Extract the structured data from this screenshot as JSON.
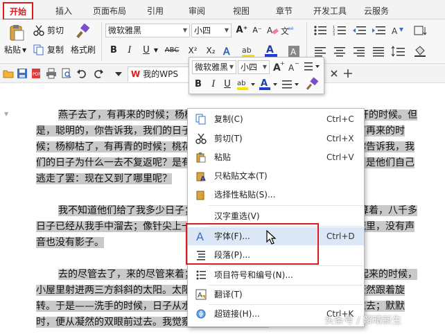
{
  "tabs": [
    "开始",
    "插入",
    "页面布局",
    "引用",
    "审阅",
    "视图",
    "章节",
    "开发工具",
    "云服务"
  ],
  "ribbon": {
    "paste_label": "粘贴",
    "cut_label": "剪切",
    "copy_label": "复制",
    "format_painter_label": "格式刷",
    "font_name": "微软雅黑",
    "font_size": "小四",
    "bold": "B",
    "italic": "I",
    "underline": "U",
    "strike": "ABC",
    "superscript": "X²",
    "subscript": "X₂",
    "font_color_glyph": "A",
    "grow_font": "A⁺",
    "shrink_font": "A⁻"
  },
  "qbar": {
    "doc_tab": "我的WPS",
    "wps_logo": "W"
  },
  "minibar": {
    "font_name": "微软雅黑",
    "font_size": "小四",
    "bold": "B",
    "italic": "I",
    "underline": "U"
  },
  "document": {
    "paragraphs": [
      "燕子去了，有再来的时候；杨柳枯了，有再青的时候；桃花谢了，有再开的时候。但是，聪明的，你告诉我，我们的日子为什么一去不复返呢？……燕子去了，有再来的时候；杨柳枯了，有再青的时候；桃花谢了，有再开的时候。但是，聪明的，你告诉我，我们的日子为什么一去不复返呢？是有人偷了他们罢：那是谁？又藏在何处呢？是他们自己逃走了罢：现在又到了哪里呢？",
      "我不知道他们给了我多少日子；但我的手确乎是渐渐空虚了。在默默里算着，八千多日子已经从我手中溜去；像针尖上一滴水滴在大海里，我的日子滴在时间的流里，没有声音也没有影子。",
      "去的尽管去了，来的尽管来着；去来的中间，又怎样地匆匆呢？早上我起来的时候，小屋里射进两三方斜斜的太阳。太阳他有脚啊，轻轻悄悄地挪移了；我也茫茫然跟着旋转。于是——洗手的时候，日子从水盆里过去；吃饭的时候，日子从饭碗里过去；默默时，便从凝然的双眼前过去。我觉察他去的匆匆了，伸"
    ]
  },
  "context_menu": {
    "items": [
      {
        "label": "复制(C)",
        "shortcut": "Ctrl+C",
        "icon": "copy-icon"
      },
      {
        "label": "剪切(T)",
        "shortcut": "Ctrl+X",
        "icon": "scissors-icon"
      },
      {
        "label": "粘贴",
        "shortcut": "Ctrl+V",
        "icon": "paste-icon"
      },
      {
        "label": "只粘贴文本(T)",
        "shortcut": "",
        "icon": "paste-text-icon"
      },
      {
        "label": "选择性粘贴(S)...",
        "shortcut": "",
        "icon": "paste-special-icon"
      },
      {
        "label": "汉字重选(V)",
        "shortcut": "",
        "icon": ""
      },
      {
        "label": "字体(F)...",
        "shortcut": "Ctrl+D",
        "icon": "font-icon"
      },
      {
        "label": "段落(P)...",
        "shortcut": "",
        "icon": "paragraph-icon"
      },
      {
        "label": "项目符号和编号(N)...",
        "shortcut": "",
        "icon": "bullets-icon"
      },
      {
        "label": "翻译(T)",
        "shortcut": "",
        "icon": "translate-icon"
      },
      {
        "label": "超链接(H)...",
        "shortcut": "Ctrl+K",
        "icon": "hyperlink-icon"
      }
    ]
  },
  "watermark": "头条号 / 解晴新生",
  "colors": {
    "accent_red": "#e0191b",
    "selection_gray": "#c9c9c9",
    "highlight_blue": "#dbe7f7"
  }
}
